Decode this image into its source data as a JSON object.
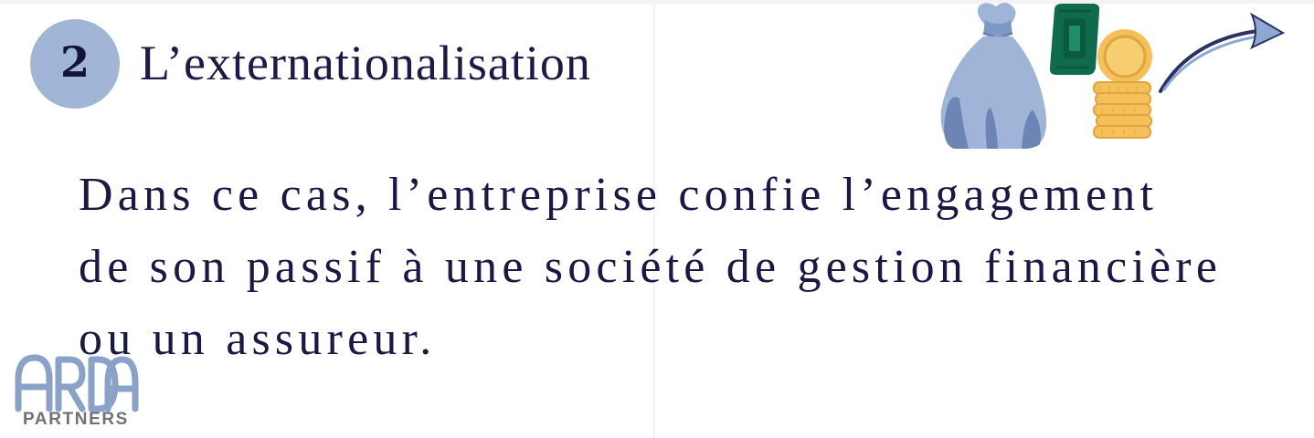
{
  "step": {
    "number": "2",
    "title": "L’externationalisation"
  },
  "body": {
    "lines": [
      "Dans ce cas, l’entreprise confie l’engagement",
      "de son passif à une société de gestion financière",
      "ou un assureur."
    ]
  },
  "illustration": {
    "icons": [
      "money-bag-icon",
      "banknote-icon",
      "coin-stack-icon",
      "arrow-up-right-icon"
    ],
    "colors": {
      "bag": "#9fb4d6",
      "bag_shadow": "#6c85b5",
      "banknote": "#0f6b4e",
      "coin": "#f5c05a",
      "arrow": "#2e3163",
      "arrow_head": "#8ea8d4"
    }
  },
  "logo": {
    "caption": "PARTNERS",
    "mark_text": "ARDA",
    "colors": {
      "mark": "#8aa2c9",
      "caption": "#6e7178"
    }
  },
  "colors": {
    "text": "#1a1946",
    "badge": "#a1b6d6",
    "background": "#ffffff"
  }
}
